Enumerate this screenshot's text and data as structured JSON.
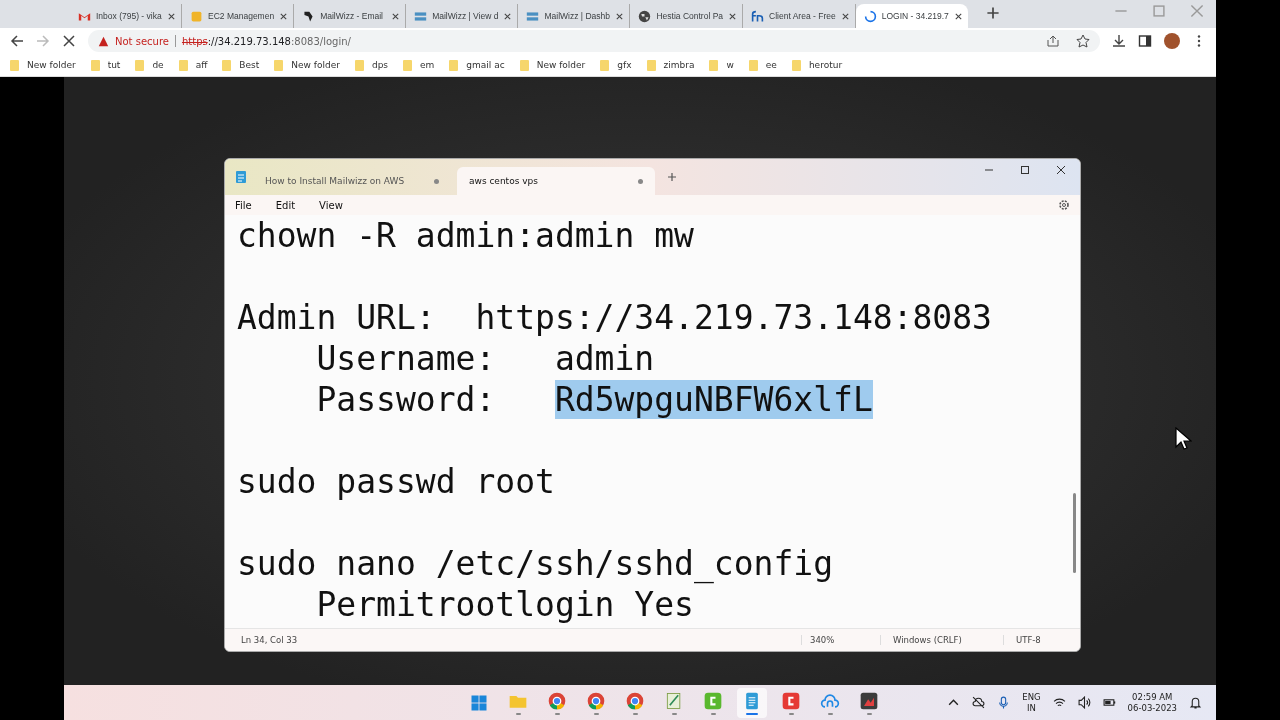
{
  "browser": {
    "tabs": [
      {
        "title": "Inbox (795) - vika",
        "selected": false
      },
      {
        "title": "EC2 Managemen",
        "selected": false
      },
      {
        "title": "MailWizz - Email",
        "selected": false
      },
      {
        "title": "MailWizz | View d",
        "selected": false
      },
      {
        "title": "MailWizz | Dashb",
        "selected": false
      },
      {
        "title": "Hestia Control Pa",
        "selected": false
      },
      {
        "title": "Client Area - Free",
        "selected": false
      },
      {
        "title": "LOGIN - 34.219.7",
        "selected": true
      }
    ],
    "security": "Not secure",
    "url_scheme": "https",
    "url_host": "://34.219.73.148",
    "url_rest": ":8083/login/",
    "bookmarks": [
      "New folder",
      "tut",
      "de",
      "aff",
      "Best",
      "New folder",
      "dps",
      "em",
      "gmail ac",
      "New folder",
      "gfx",
      "zimbra",
      "w",
      "ee",
      "herotur"
    ]
  },
  "notepad": {
    "tabs": [
      {
        "title": "How to Install Mailwizz on AWS",
        "selected": false
      },
      {
        "title": "aws centos vps",
        "selected": true
      }
    ],
    "menu": [
      "File",
      "Edit",
      "View"
    ],
    "lines": [
      [
        [
          {
            "text": "chown -R admin:admin mw",
            "selected": false
          }
        ]
      ],
      [
        [
          {
            "text": "Admin URL:  https://34.219.73.148:8083",
            "selected": false
          }
        ],
        [
          {
            "text": "    Username:   admin",
            "selected": false
          }
        ],
        [
          {
            "text": "    Password:   ",
            "selected": false
          },
          {
            "text": "Rd5wpguNBFW6xlfL",
            "selected": true
          }
        ]
      ],
      [
        [
          {
            "text": "sudo passwd root",
            "selected": false
          }
        ]
      ],
      [
        [
          {
            "text": "sudo nano /etc/ssh/sshd_config",
            "selected": false
          }
        ],
        [
          {
            "text": "    Permitrootlogin Yes",
            "selected": false
          }
        ]
      ]
    ],
    "status": {
      "position": "Ln 34, Col 33",
      "zoom": "340%",
      "line_ending": "Windows (CRLF)",
      "encoding": "UTF-8"
    }
  },
  "taskbar": {
    "apps": [
      {
        "kind": "start",
        "active": false
      },
      {
        "kind": "folder",
        "active": false
      },
      {
        "kind": "chrome",
        "active": false
      },
      {
        "kind": "chrome",
        "active": false
      },
      {
        "kind": "chrome",
        "active": false
      },
      {
        "kind": "editor",
        "active": false
      },
      {
        "kind": "green",
        "active": false
      },
      {
        "kind": "notepad",
        "active": true
      },
      {
        "kind": "red",
        "active": false
      },
      {
        "kind": "cloud",
        "active": false
      },
      {
        "kind": "dark",
        "active": false
      }
    ],
    "language": "ENG",
    "region": "IN",
    "time": "02:59 AM",
    "date": "06-03-2023"
  }
}
